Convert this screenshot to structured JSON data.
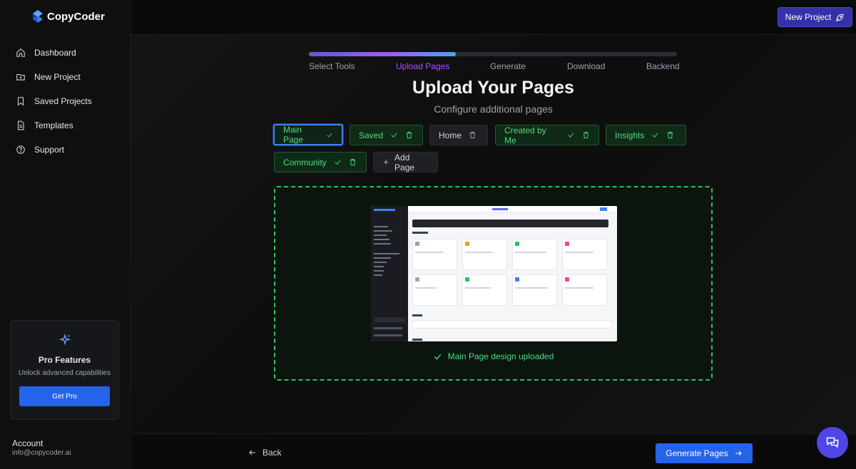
{
  "app": {
    "name": "CopyCoder"
  },
  "sidebar": {
    "items": [
      {
        "label": "Dashboard",
        "icon": "home-icon"
      },
      {
        "label": "New Project",
        "icon": "folder-plus-icon"
      },
      {
        "label": "Saved Projects",
        "icon": "bookmark-icon"
      },
      {
        "label": "Templates",
        "icon": "file-icon"
      },
      {
        "label": "Support",
        "icon": "help-circle-icon"
      }
    ],
    "pro": {
      "title": "Pro Features",
      "subtitle": "Unlock advanced capabilities",
      "button": "Get Pro"
    },
    "account": {
      "label": "Account",
      "email": "info@copycoder.ai"
    }
  },
  "header": {
    "new_project": "New Project"
  },
  "wizard": {
    "progress": 0.4,
    "steps": [
      "Select Tools",
      "Upload Pages",
      "Generate",
      "Download",
      "Backend"
    ],
    "active_step": 1,
    "title": "Upload Your Pages",
    "subtitle": "Configure additional pages"
  },
  "pages": [
    {
      "label": "Main Page",
      "status": "uploaded",
      "selected": true
    },
    {
      "label": "Saved",
      "status": "uploaded"
    },
    {
      "label": "Home",
      "status": "empty"
    },
    {
      "label": "Created by Me",
      "status": "uploaded"
    },
    {
      "label": "Insights",
      "status": "uploaded"
    },
    {
      "label": "Community",
      "status": "uploaded"
    }
  ],
  "add_page": "Add Page",
  "upload": {
    "message": "Main Page design uploaded"
  },
  "footer": {
    "back": "Back",
    "generate": "Generate Pages"
  },
  "colors": {
    "accent": "#2563eb",
    "success": "#4ade80",
    "progress_purple": "#a855f7",
    "header_button": "#3532a8"
  }
}
